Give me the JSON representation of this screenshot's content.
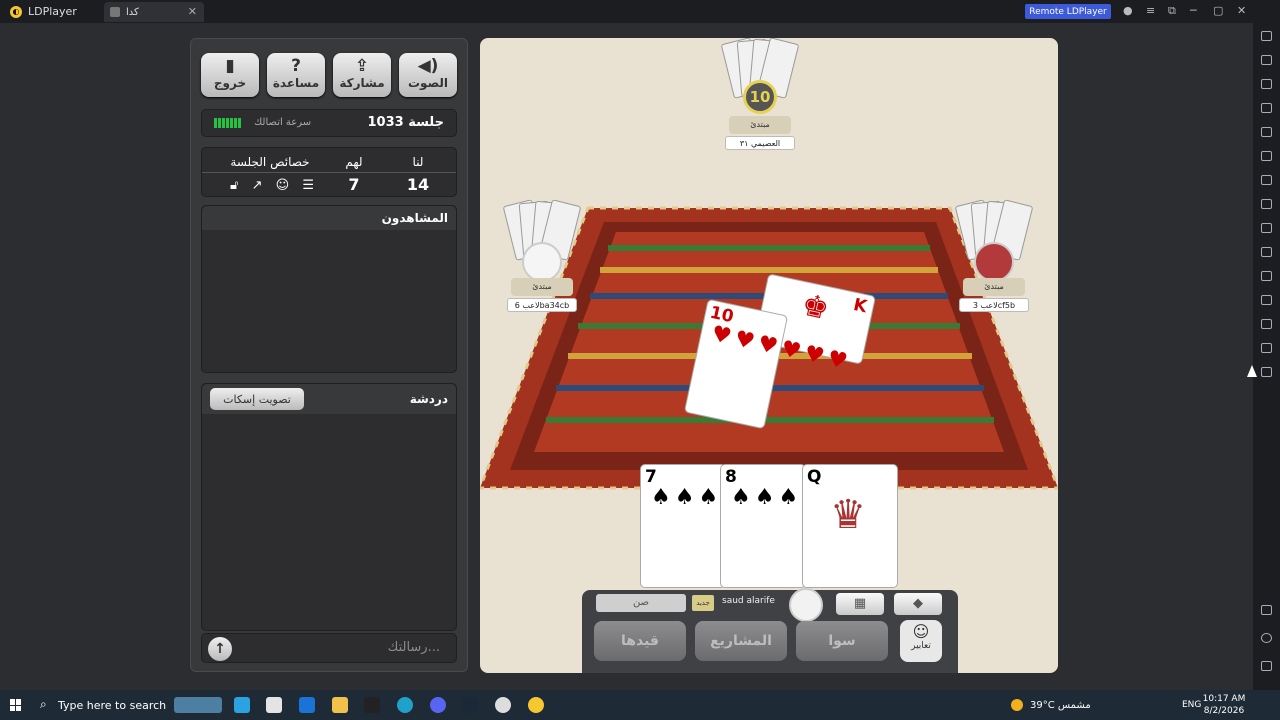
{
  "window": {
    "app_name": "LDPlayer",
    "tab_title": "كدا",
    "remote_button": "Remote LDPlayer"
  },
  "sidepanel": {
    "buttons": [
      {
        "label": "خروج",
        "icon": "exit-door-icon"
      },
      {
        "label": "مساعدة",
        "icon": "help-icon"
      },
      {
        "label": "مشاركة",
        "icon": "share-icon"
      },
      {
        "label": "الصوت",
        "icon": "speaker-icon"
      }
    ],
    "session": "جلسة 1033",
    "connection": "سرعة اتصالك",
    "score": {
      "props_header": "خصائص الجلسة",
      "them_header": "لهم",
      "us_header": "لنا",
      "them": "7",
      "us": "14"
    },
    "watchers_title": "المشاهدون",
    "chat_title": "دردشة",
    "mute_vote": "تصويت إسكات",
    "chat_placeholder": "رسالتك..."
  },
  "game": {
    "top_player": {
      "name": "العصيمي ٣١",
      "badge": "مبتدئ",
      "timer": "10"
    },
    "left_player": {
      "name": "لاعب 6ba34cb",
      "badge": "مبتدئ"
    },
    "right_player": {
      "name": "لاعب 3cf5b",
      "badge": "مبتدئ"
    },
    "table_cards": [
      {
        "rank": "10",
        "suit": "hearts"
      },
      {
        "rank": "K",
        "suit": "hearts"
      }
    ],
    "hand": [
      {
        "rank": "7",
        "suit": "spades"
      },
      {
        "rank": "8",
        "suit": "spades"
      },
      {
        "rank": "Q",
        "suit": "spades"
      }
    ],
    "bottom": {
      "trump": "صن",
      "new_badge": "جديد",
      "username": "saud alarife",
      "btn_qaydha": "قيدها",
      "btn_projects": "المشاريع",
      "btn_sawa": "سوا",
      "btn_emotes": "تعابير"
    }
  },
  "taskbar": {
    "search_placeholder": "Type here to search",
    "weather": "39°C  مشمس",
    "lang": "ENG",
    "time": "10:17 AM",
    "date": "8/2/2026"
  }
}
